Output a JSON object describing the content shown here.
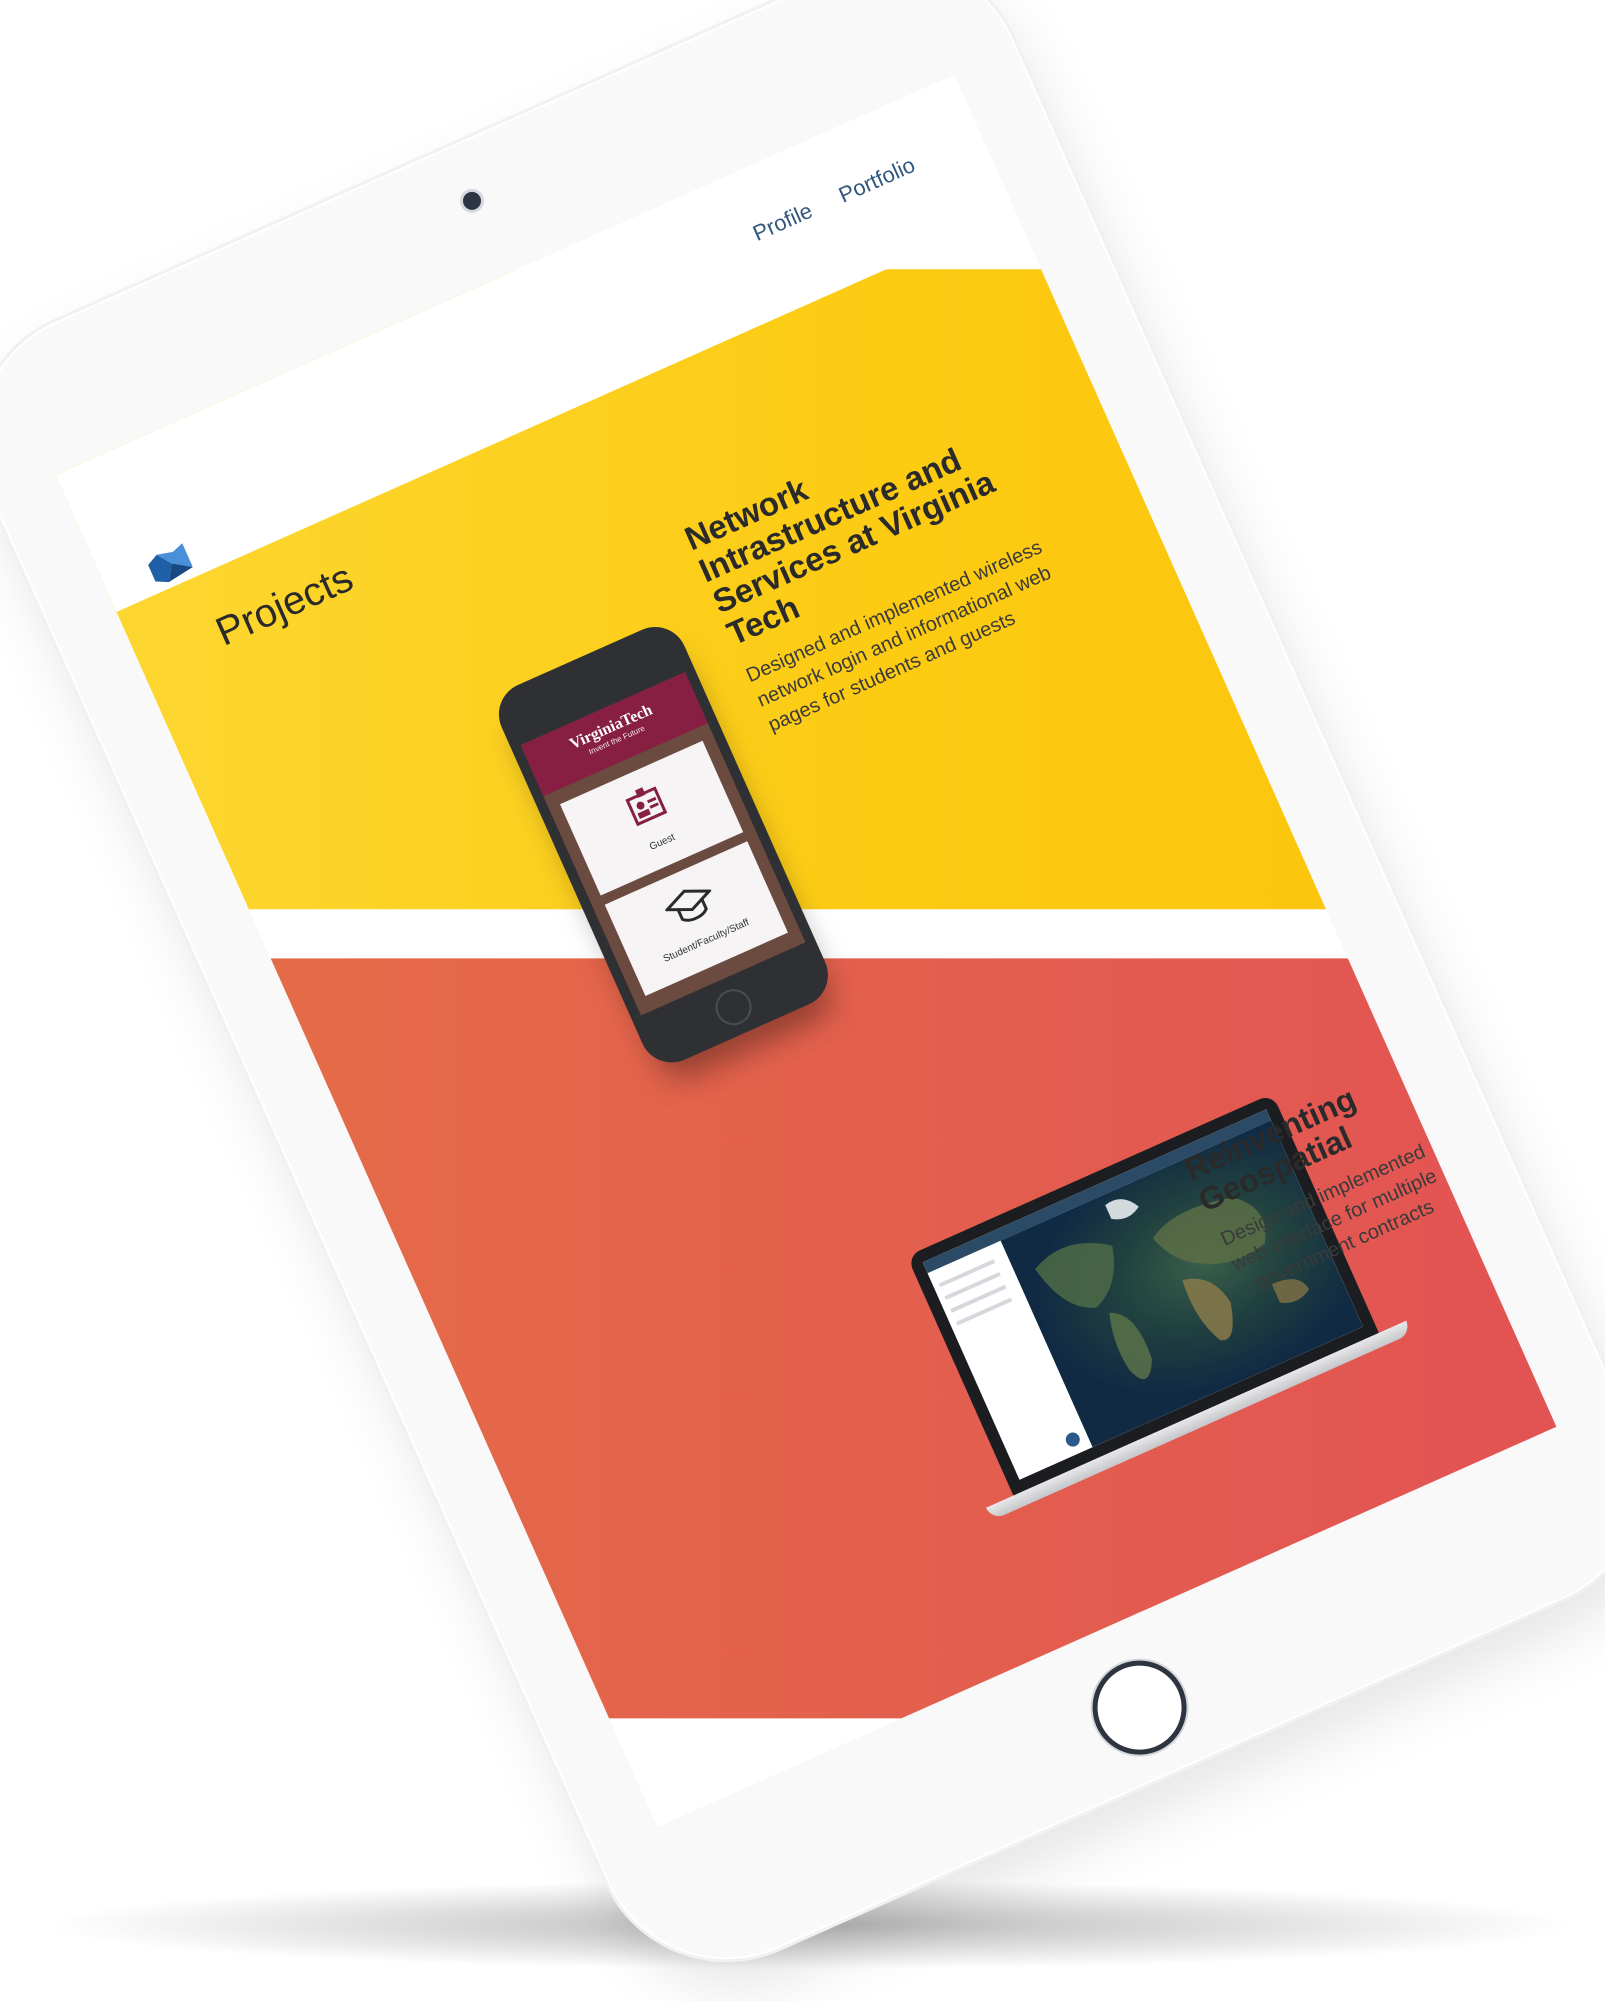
{
  "nav": {
    "profile_label": "Profile",
    "portfolio_label": "Portfolio"
  },
  "brand": {
    "logo_colors": [
      "#1f5fa8",
      "#4a90d9"
    ]
  },
  "page": {
    "section_title": "Projects"
  },
  "projects": [
    {
      "title": "Network Intrastructure and Services at Virginia Tech",
      "description": "Designed and implemented wireless network login and informational web pages for students and guests",
      "band_color": "#fcc20a",
      "mockup": {
        "type": "phone",
        "brand_name": "VirginiaTech",
        "brand_tagline": "Invent the Future",
        "cards": [
          "Guest",
          "Student/Faculty/Staff"
        ]
      }
    },
    {
      "title": "Reinventing Geospatial",
      "description": "Design and implemented web interface for multiple government contracts",
      "band_color": "#e24a56",
      "mockup": {
        "type": "laptop"
      }
    }
  ],
  "colors": {
    "nav_link": "#32577c",
    "yellow_band": "#fccb12",
    "red_band": "#e35b50"
  }
}
